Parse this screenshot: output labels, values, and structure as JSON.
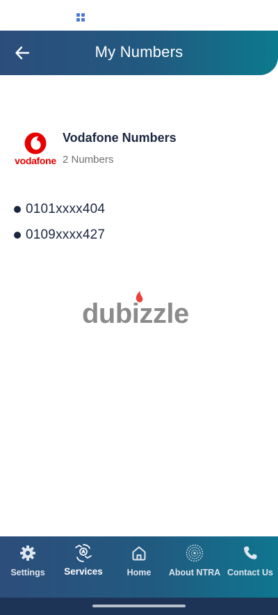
{
  "status_bar": {
    "app_icon": "grid-app-icon"
  },
  "header": {
    "back_icon": "arrow-left-icon",
    "title": "My Numbers",
    "colors": {
      "gradient_start": "#2c4d7c",
      "gradient_end": "#0c7a8e"
    }
  },
  "operator": {
    "logo_icon": "vodafone-logo-icon",
    "logo_text": "vodafone",
    "title": "Vodafone Numbers",
    "count_label": "2 Numbers",
    "brand_color": "#e60000"
  },
  "numbers": [
    {
      "value": "0101xxxx404"
    },
    {
      "value": "0109xxxx427"
    }
  ],
  "watermark": {
    "icon": "dubizzle-logo-icon",
    "text": "dubizzle"
  },
  "bottom_nav": {
    "items": [
      {
        "label": "Settings",
        "icon": "gear-icon",
        "active": false
      },
      {
        "label": "Services",
        "icon": "services-hands-icon",
        "active": true
      },
      {
        "label": "Home",
        "icon": "home-icon",
        "active": false
      },
      {
        "label": "About NTRA",
        "icon": "ntra-logo-icon",
        "active": false
      },
      {
        "label": "Contact Us",
        "icon": "phone-icon",
        "active": false
      }
    ]
  }
}
